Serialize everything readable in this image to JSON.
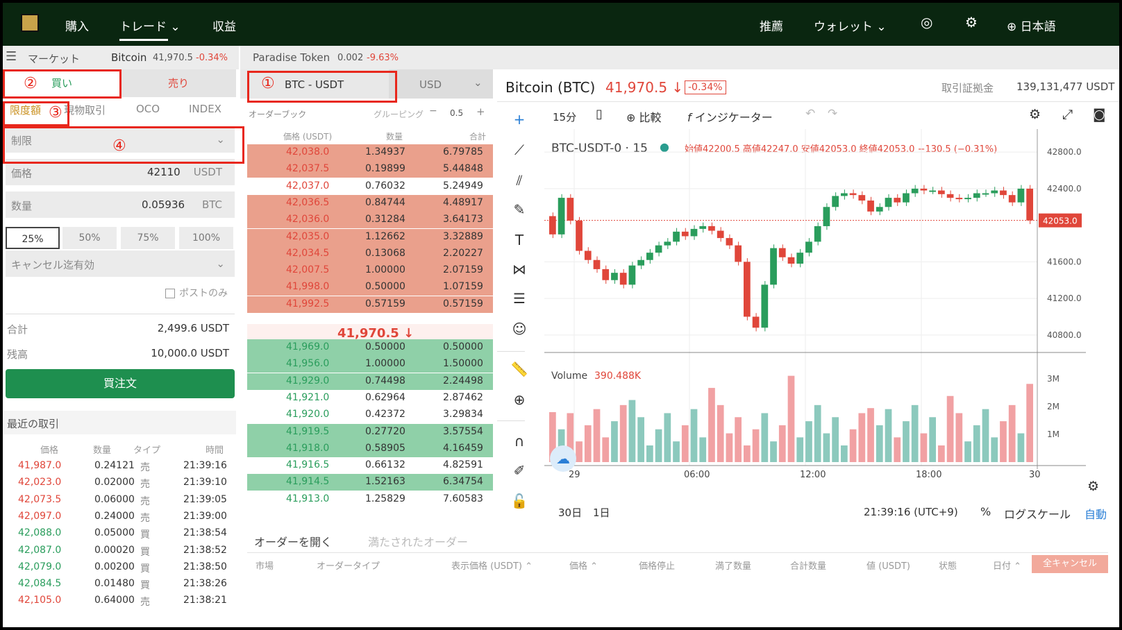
{
  "top": {
    "buy": "購入",
    "trade": "トレード",
    "earn": "収益",
    "recommend": "推薦",
    "wallet": "ウォレット",
    "lang": "日本語"
  },
  "ticker": {
    "market": "マーケット",
    "t1name": "Bitcoin",
    "t1price": "41,970.5",
    "t1chg": "-0.34%",
    "t2name": "Paradise Token",
    "t2price": "0.002",
    "t2chg": "-9.63%"
  },
  "order": {
    "buy": "買い",
    "sell": "売り",
    "tab1": "限度額",
    "tab2": "現物取引",
    "tab3": "OCO",
    "tab4": "INDEX",
    "type": "制限",
    "price_label": "価格",
    "price": "42110",
    "price_unit": "USDT",
    "qty_label": "数量",
    "qty": "0.05936",
    "qty_unit": "BTC",
    "pcts": [
      "25%",
      "50%",
      "75%",
      "100%"
    ],
    "tif": "キャンセル迄有効",
    "post": "ポストのみ",
    "total_label": "合計",
    "total": "2,499.6 USDT",
    "bal_label": "残高",
    "bal": "10,000.0 USDT",
    "submit": "買注文"
  },
  "ann": {
    "n1": "①",
    "n2": "②",
    "n3": "③",
    "n4": "④"
  },
  "trades": {
    "title": "最近の取引",
    "h": [
      "価格",
      "数量",
      "タイプ",
      "時間"
    ],
    "rows": [
      [
        "41,987.0",
        "0.24121",
        "売",
        "21:39:16"
      ],
      [
        "42,023.0",
        "0.02000",
        "売",
        "21:39:10"
      ],
      [
        "42,073.5",
        "0.06000",
        "売",
        "21:39:05"
      ],
      [
        "42,097.0",
        "0.24000",
        "売",
        "21:39:00"
      ],
      [
        "42,088.0",
        "0.05000",
        "買",
        "21:38:54"
      ],
      [
        "42,087.0",
        "0.00020",
        "買",
        "21:38:52"
      ],
      [
        "42,079.0",
        "0.00200",
        "買",
        "21:38:50"
      ],
      [
        "42,084.5",
        "0.01480",
        "買",
        "21:38:26"
      ],
      [
        "42,105.0",
        "0.64000",
        "売",
        "21:38:21"
      ]
    ]
  },
  "book": {
    "pair": "BTC - USDT",
    "unit": "USD",
    "title": "オーダーブック",
    "group": "グルーピング",
    "step": "0.5",
    "h": [
      "価格 (USDT)",
      "数量",
      "合計"
    ],
    "asks": [
      [
        "42,038.0",
        "1.34937",
        "6.79785"
      ],
      [
        "42,037.5",
        "0.19899",
        "5.44848"
      ],
      [
        "42,037.0",
        "0.76032",
        "5.24949"
      ],
      [
        "42,036.5",
        "0.84744",
        "4.48917"
      ],
      [
        "42,036.0",
        "0.31284",
        "3.64173"
      ],
      [
        "42,035.0",
        "1.12662",
        "3.32889"
      ],
      [
        "42,034.5",
        "0.13068",
        "2.20227"
      ],
      [
        "42,007.5",
        "1.00000",
        "2.07159"
      ],
      [
        "41,998.0",
        "0.50000",
        "1.07159"
      ],
      [
        "41,992.5",
        "0.57159",
        "0.57159"
      ]
    ],
    "mid": "41,970.5 ↓",
    "bids": [
      [
        "41,969.0",
        "0.50000",
        "0.50000"
      ],
      [
        "41,956.0",
        "1.00000",
        "1.50000"
      ],
      [
        "41,929.0",
        "0.74498",
        "2.24498"
      ],
      [
        "41,921.0",
        "0.62964",
        "2.87462"
      ],
      [
        "41,920.0",
        "0.42372",
        "3.29834"
      ],
      [
        "41,919.5",
        "0.27720",
        "3.57554"
      ],
      [
        "41,918.0",
        "0.58905",
        "4.16459"
      ],
      [
        "41,916.5",
        "0.66132",
        "4.82591"
      ],
      [
        "41,914.5",
        "1.52163",
        "6.34754"
      ],
      [
        "41,913.0",
        "1.25829",
        "7.60583"
      ]
    ]
  },
  "chart": {
    "title": "Bitcoin (BTC)",
    "price": "41,970.5 ↓",
    "chg": "-0.34%",
    "margin_label": "取引証拠金",
    "margin": "139,131,477 USDT",
    "interval": "15分",
    "compare": "比較",
    "indicator": "インジケーター",
    "symbol": "BTC-USDT-0 · 15",
    "ohlc": "始値42200.5 高値42247.0 安値42053.0 終値42053.0 −130.5 (−0.31%)",
    "yticks": [
      "42800.0",
      "42400.0",
      "41600.0",
      "41200.0",
      "40800.0"
    ],
    "last": "42053.0",
    "vol_label": "Volume",
    "vol": "390.488K",
    "vticks": [
      "3M",
      "2M",
      "1M"
    ],
    "xticks": [
      "29",
      "06:00",
      "12:00",
      "18:00",
      "30"
    ],
    "r1": "30日",
    "r2": "1日",
    "time": "21:39:16 (UTC+9)",
    "pct": "%",
    "log": "ログスケール",
    "auto": "自動",
    "closes": [
      41900,
      42300,
      42050,
      41720,
      41620,
      41520,
      41400,
      41480,
      41350,
      41560,
      41620,
      41700,
      41780,
      41820,
      41930,
      41880,
      41960,
      41990,
      41940,
      41860,
      41780,
      41600,
      41000,
      40880,
      41350,
      41750,
      41650,
      41580,
      41700,
      41820,
      41990,
      42200,
      42320,
      42350,
      42330,
      42270,
      42150,
      42200,
      42300,
      42250,
      42350,
      42400,
      42380,
      42380,
      42340,
      42300,
      42290,
      42300,
      42350,
      42350,
      42380,
      42330,
      42250,
      42400,
      42053
    ]
  },
  "orders": {
    "tab1": "オーダーを開く",
    "tab2": "満たされたオーダー",
    "h": [
      "市場",
      "オーダータイプ",
      "表示価格 (USDT) ⌃",
      "価格 ⌃",
      "価格停止",
      "満了数量",
      "合計数量",
      "値 (USDT)",
      "状態",
      "日付 ⌃"
    ],
    "cancel": "全キャンセル"
  },
  "colors": {
    "up": "#2a9d5c",
    "down": "#e0463a",
    "askbg": "#eaa08c",
    "bidbg": "#8fd0a8",
    "vol_up": "#8cc9bd",
    "vol_down": "#f1a1a3",
    "accent": "#0a2610"
  }
}
